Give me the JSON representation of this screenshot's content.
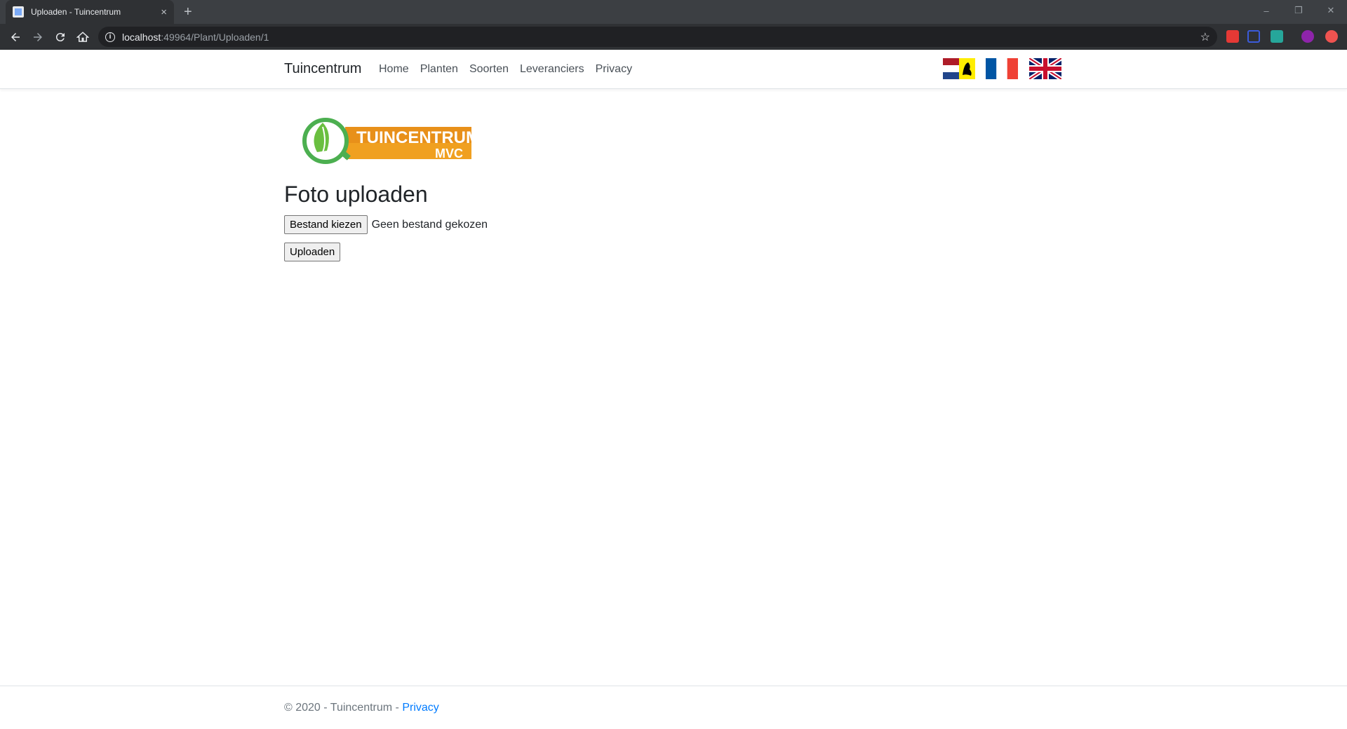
{
  "browser": {
    "tab_title": "Uploaden - Tuincentrum",
    "tab_close": "×",
    "new_tab": "+",
    "url_host": "localhost",
    "url_path": ":49964/Plant/Uploaden/1",
    "window_controls": [
      "–",
      "❐",
      "✕"
    ]
  },
  "navbar": {
    "brand": "Tuincentrum",
    "links": [
      "Home",
      "Planten",
      "Soorten",
      "Leveranciers",
      "Privacy"
    ],
    "flags": [
      "nl-flag",
      "fr-flag",
      "uk-flag"
    ]
  },
  "main": {
    "logo_text_top": "TUINCENTRUM",
    "logo_text_bottom": "MVC",
    "heading": "Foto uploaden",
    "choose_file_label": "Bestand kiezen",
    "no_file_text": "Geen bestand gekozen",
    "upload_label": "Uploaden"
  },
  "footer": {
    "text": "© 2020 - Tuincentrum - ",
    "privacy_link": "Privacy"
  },
  "colors": {
    "accent_link": "#007bff",
    "logo_green": "#4caf50",
    "logo_orange": "#f0a020"
  }
}
